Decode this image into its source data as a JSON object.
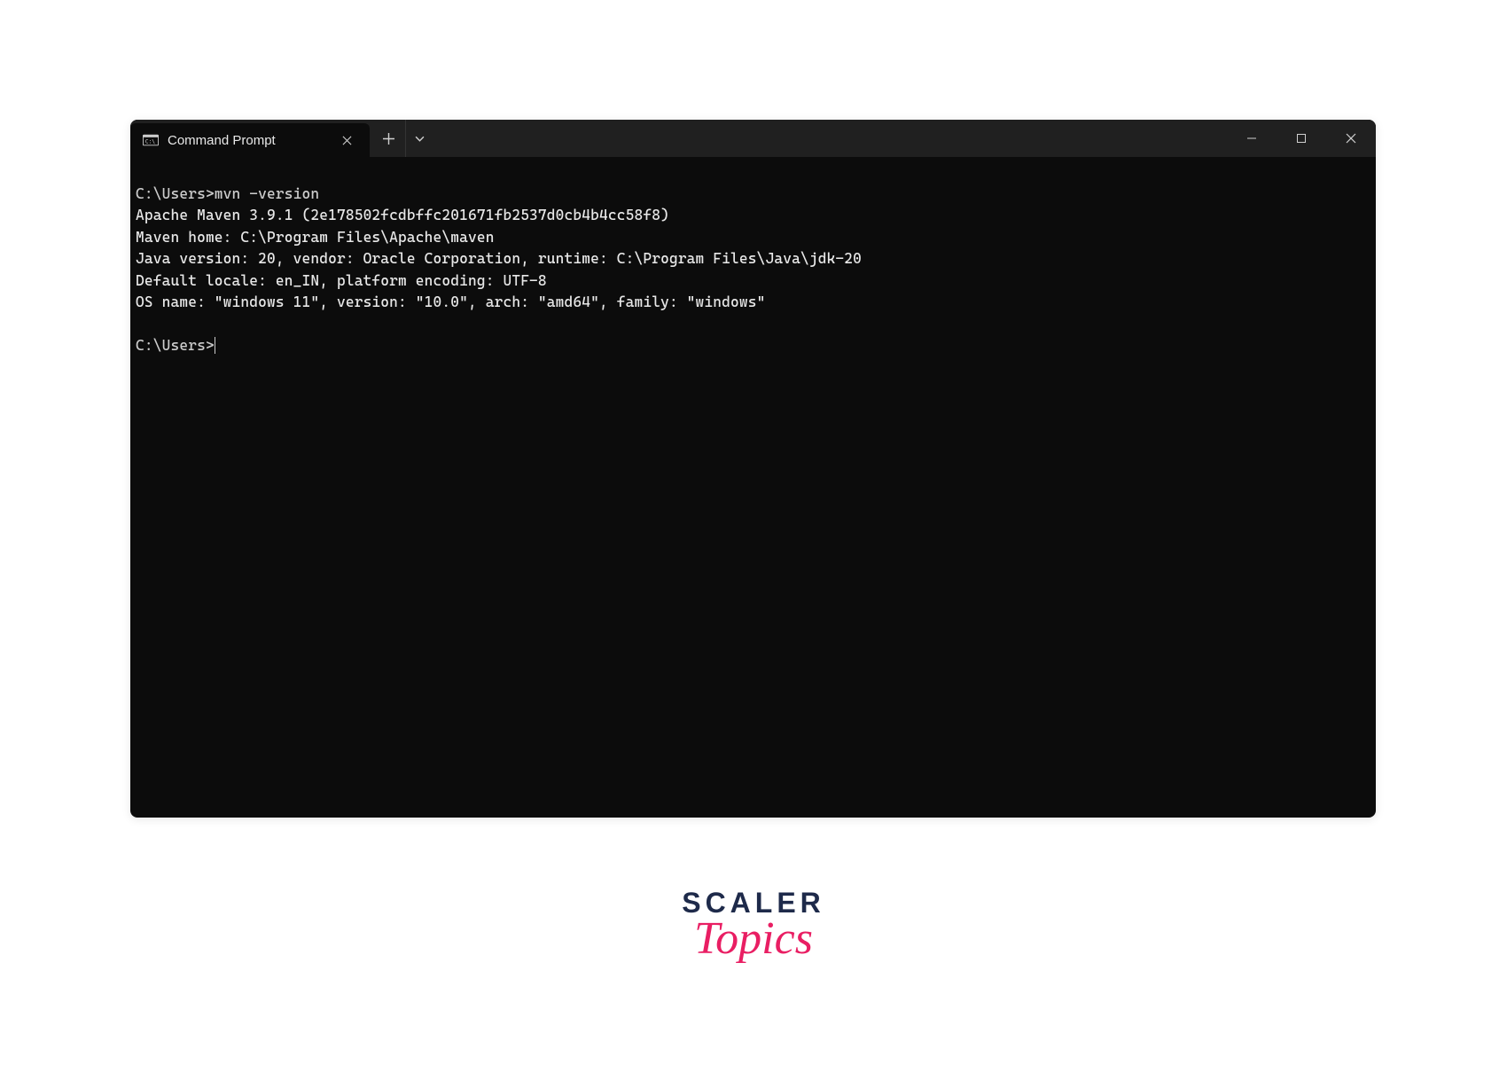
{
  "tab": {
    "title": "Command Prompt"
  },
  "terminal": {
    "lines": [
      {
        "cls": "prompt-line",
        "text": "C:\\Users>mvn -version"
      },
      {
        "cls": "output-line",
        "text": "Apache Maven 3.9.1 (2e178502fcdbffc201671fb2537d0cb4b4cc58f8)"
      },
      {
        "cls": "output-line",
        "text": "Maven home: C:\\Program Files\\Apache\\maven"
      },
      {
        "cls": "output-line",
        "text": "Java version: 20, vendor: Oracle Corporation, runtime: C:\\Program Files\\Java\\jdk-20"
      },
      {
        "cls": "output-line",
        "text": "Default locale: en_IN, platform encoding: UTF-8"
      },
      {
        "cls": "output-line",
        "text": "OS name: \"windows 11\", version: \"10.0\", arch: \"amd64\", family: \"windows\""
      }
    ],
    "currentPrompt": "C:\\Users>"
  },
  "branding": {
    "line1": "SCALER",
    "line2": "Topics"
  }
}
